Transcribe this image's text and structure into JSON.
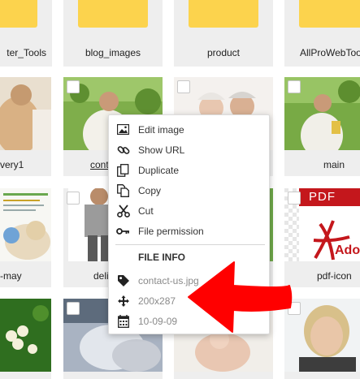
{
  "grid": {
    "row1": [
      "ter_Tools",
      "blog_images",
      "product",
      "AllProWebToo"
    ],
    "row2": [
      "very1",
      "cont",
      "",
      "main"
    ],
    "row3": [
      "-may",
      "deli",
      "",
      "pdf-icon"
    ]
  },
  "thumbs": {
    "pdf_label": "PDF",
    "adobe_label": "Adob"
  },
  "context_menu": {
    "items": [
      "Edit image",
      "Show URL",
      "Duplicate",
      "Copy",
      "Cut",
      "File permission"
    ],
    "info_heading": "FILE INFO",
    "file_name": "contact-us.jpg",
    "dimensions": "200x287",
    "date": "10-09-09"
  },
  "colors": {
    "folder": "#fcd34d",
    "annotation_arrow": "#ff0000",
    "tile_bg": "#eeeeee"
  }
}
